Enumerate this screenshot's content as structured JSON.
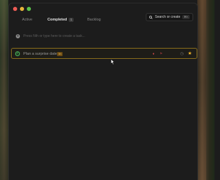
{
  "tabs": [
    {
      "label": "Active"
    },
    {
      "label": "Completed",
      "badge": "1"
    },
    {
      "label": "Backlog"
    }
  ],
  "search": {
    "label": "Search or create",
    "shortcut": "⌘K"
  },
  "new_task": {
    "placeholder": "Press Nth or type here to create a task..."
  },
  "tasks": [
    {
      "title": "Plan a surprise date",
      "badge": "5h",
      "priority_icon": "♦",
      "starred": true
    }
  ],
  "colors": {
    "accent": "#f0b429",
    "complete": "#49b35a",
    "border_highlight": "#8c6f1c"
  }
}
